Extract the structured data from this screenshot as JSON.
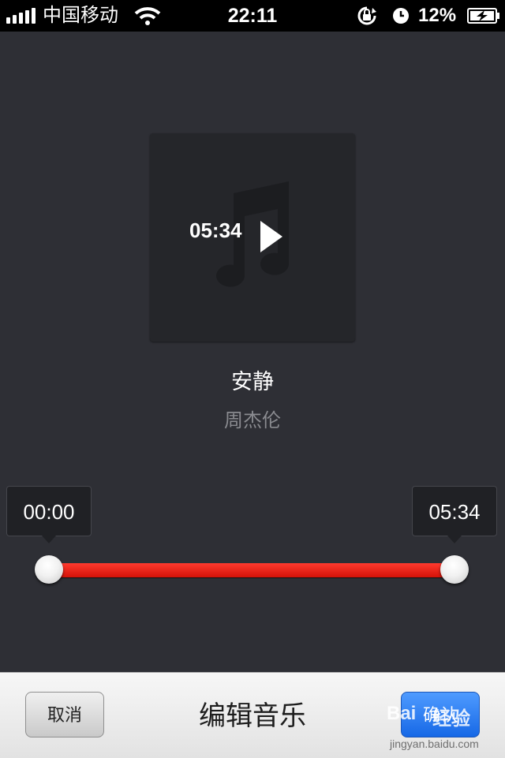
{
  "status_bar": {
    "carrier": "中国移动",
    "time": "22:11",
    "battery_percent": "12%",
    "icons": [
      "signal-icon",
      "wifi-icon",
      "rotation-lock-icon",
      "alarm-clock-icon",
      "battery-charging-icon"
    ]
  },
  "album": {
    "duration": "05:34",
    "icons": [
      "music-note-icon",
      "play-icon"
    ]
  },
  "song": {
    "title": "安静",
    "artist": "周杰伦"
  },
  "trim": {
    "start_label": "00:00",
    "end_label": "05:34",
    "start_fraction": 0,
    "end_fraction": 1,
    "track_color": "#e0150b"
  },
  "bottom_bar": {
    "cancel_label": "取消",
    "title": "编辑音乐",
    "confirm_label": "确认",
    "confirm_color": "#1f73ee"
  },
  "watermark": {
    "brand": "Bai",
    "brand_cn": "经验",
    "url": "jingyan.baidu.com"
  }
}
